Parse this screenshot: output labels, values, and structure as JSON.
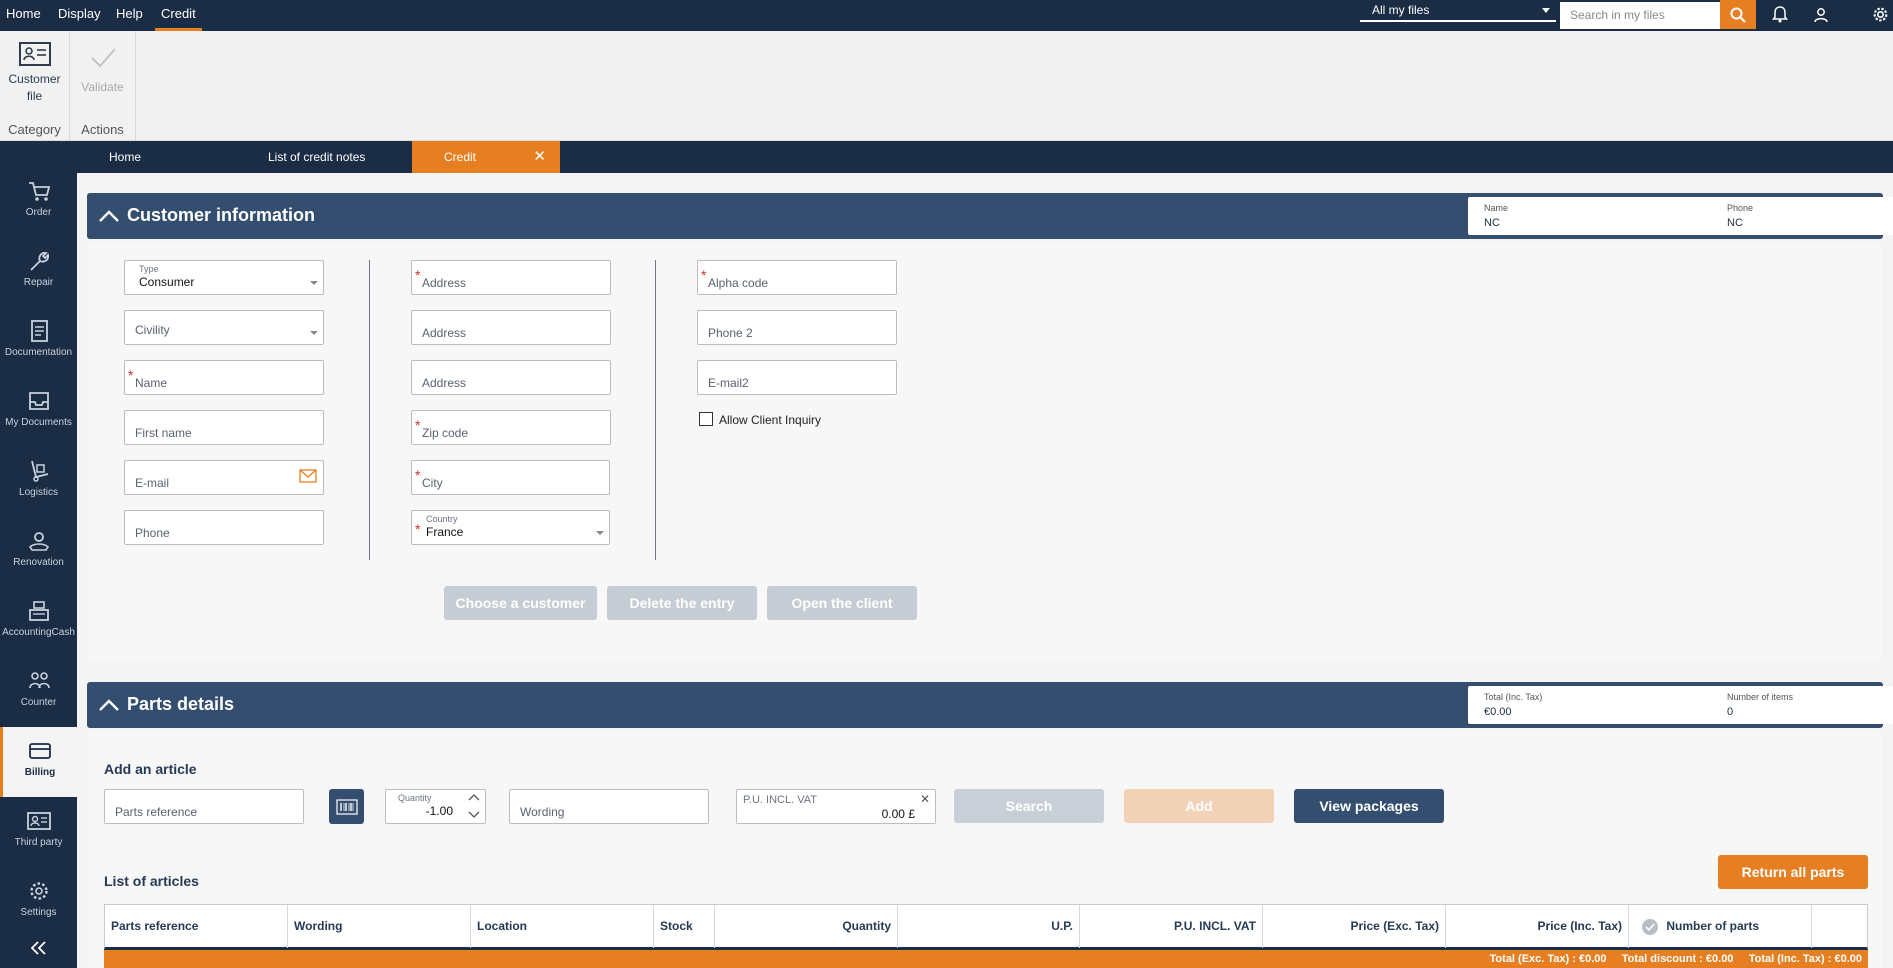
{
  "menu": {
    "items": [
      "Home",
      "Display",
      "Help",
      "Credit"
    ]
  },
  "topbar": {
    "scope_label": "All my files",
    "search_placeholder": "Search in my files"
  },
  "ribbon": {
    "customer_file": "Customer file",
    "category": "Category",
    "validate": "Validate",
    "actions": "Actions"
  },
  "sidebar": {
    "items": [
      "Order",
      "Repair",
      "Documentation",
      "My Documents",
      "Logistics",
      "Renovation",
      "AccountingCash",
      "Counter",
      "Billing",
      "Third party",
      "Settings"
    ],
    "active": "Billing"
  },
  "tabs": [
    "Home",
    "List of credit notes",
    "Credit"
  ],
  "customer": {
    "title": "Customer information",
    "summary": {
      "name_label": "Name",
      "name_value": "NC",
      "phone_label": "Phone",
      "phone_value": "NC"
    },
    "type_label": "Type",
    "type_value": "Consumer",
    "civility": "Civility",
    "name": "Name",
    "first_name": "First name",
    "email": "E-mail",
    "phone": "Phone",
    "address1": "Address",
    "address2": "Address",
    "address3": "Address",
    "zip": "Zip code",
    "city": "City",
    "country_label": "Country",
    "country_value": "France",
    "alpha_code": "Alpha code",
    "phone2": "Phone 2",
    "email2": "E-mail2",
    "allow_inquiry": "Allow Client Inquiry",
    "btn_choose": "Choose a customer",
    "btn_delete": "Delete the entry",
    "btn_open": "Open the client"
  },
  "parts": {
    "title": "Parts details",
    "summary": {
      "total_label": "Total (Inc. Tax)",
      "total_value": "€0.00",
      "count_label": "Number of items",
      "count_value": "0"
    },
    "add_article": "Add an article",
    "parts_reference": "Parts reference",
    "quantity_label": "Quantity",
    "quantity_value": "-1.00",
    "wording": "Wording",
    "pu_label": "P.U. INCL. VAT",
    "pu_value": "0.00 £",
    "btn_search": "Search",
    "btn_add": "Add",
    "btn_packages": "View packages",
    "list_title": "List of articles",
    "btn_return_all": "Return all parts",
    "columns": [
      "Parts reference",
      "Wording",
      "Location",
      "Stock",
      "Quantity",
      "U.P.",
      "P.U. INCL. VAT",
      "Price (Exc. Tax)",
      "Price (Inc. Tax)",
      "Number of parts returned"
    ],
    "totals": "Total (Exc. Tax) : €0.00     Total discount : €0.00     Total (Inc. Tax) : €0.00"
  }
}
